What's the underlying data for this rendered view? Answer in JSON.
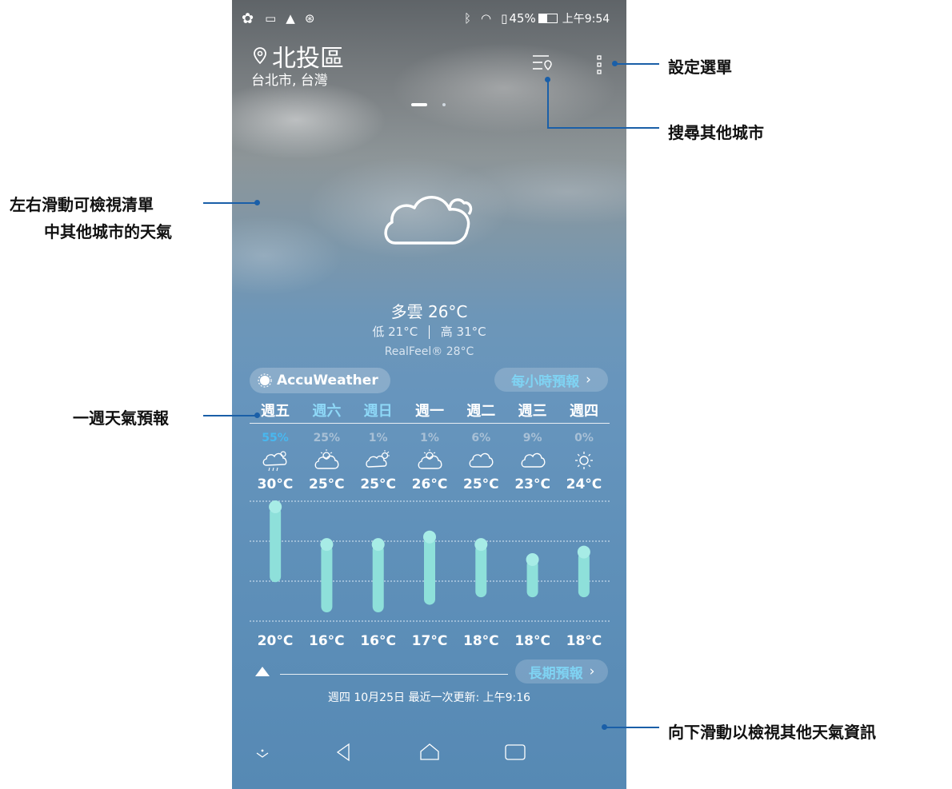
{
  "status_bar": {
    "battery": "45%",
    "time": "上午9:54"
  },
  "location": {
    "name": "北投區",
    "region": "台北市, 台灣"
  },
  "current": {
    "condition_temp": "多雲 26°C",
    "low": "低 21°C",
    "high": "高 31°C",
    "realfeel": "RealFeel® 28°C"
  },
  "provider": "AccuWeather",
  "hourly_button": "每小時預報",
  "long_term_button": "長期預報",
  "updated": "週四 10月25日 最近一次更新: 上午9:16",
  "forecast": {
    "days": [
      "週五",
      "週六",
      "週日",
      "週一",
      "週二",
      "週三",
      "週四"
    ],
    "weekend_days": [
      "週六",
      "週日"
    ],
    "precip": [
      "55%",
      "25%",
      "1%",
      "1%",
      "6%",
      "9%",
      "0%"
    ],
    "icons": [
      "cloud-rain-sun-icon",
      "sun-cloud-icon",
      "cloud-sun-icon",
      "sun-cloud-icon",
      "cloud-icon",
      "cloud-icon",
      "sun-icon"
    ],
    "highs": [
      "30°C",
      "25°C",
      "25°C",
      "26°C",
      "25°C",
      "23°C",
      "24°C"
    ],
    "lows": [
      "20°C",
      "16°C",
      "16°C",
      "17°C",
      "18°C",
      "18°C",
      "18°C"
    ],
    "high_values": [
      30,
      25,
      25,
      26,
      25,
      23,
      24
    ],
    "low_values": [
      20,
      16,
      16,
      17,
      18,
      18,
      18
    ]
  },
  "callouts": {
    "settings_menu": "設定選單",
    "search_city": "搜尋其他城市",
    "swipe_lr_line1": "左右滑動可檢視清單",
    "swipe_lr_line2": "中其他城市的天氣",
    "weekly": "一週天氣預報",
    "swipe_down": "向下滑動以檢視其他天氣資訊"
  },
  "colors": {
    "accent": "#7fd3f3",
    "bar": "#8ee0da",
    "callout_line": "#1a5fa8"
  }
}
